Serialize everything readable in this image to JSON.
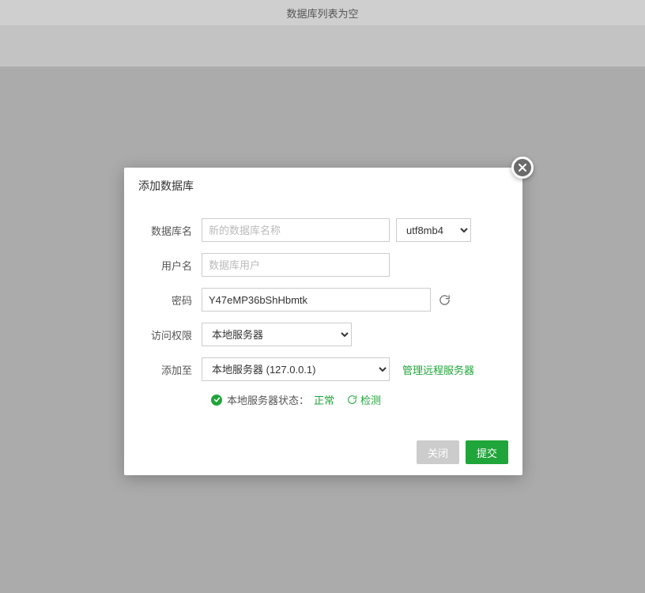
{
  "header": {
    "empty_message": "数据库列表为空"
  },
  "modal": {
    "title": "添加数据库",
    "labels": {
      "dbname": "数据库名",
      "username": "用户名",
      "password": "密码",
      "access": "访问权限",
      "addto": "添加至"
    },
    "placeholders": {
      "dbname": "新的数据库名称",
      "username": "数据库用户"
    },
    "values": {
      "password": "Y47eMP36bShHbmtk"
    },
    "selects": {
      "charset": "utf8mb4",
      "access": "本地服务器",
      "addto": "本地服务器 (127.0.0.1)"
    },
    "links": {
      "manage_remote": "管理远程服务器"
    },
    "status": {
      "prefix": "本地服务器状态：",
      "value": "正常",
      "check": "检测"
    },
    "buttons": {
      "close": "关闭",
      "submit": "提交"
    }
  }
}
